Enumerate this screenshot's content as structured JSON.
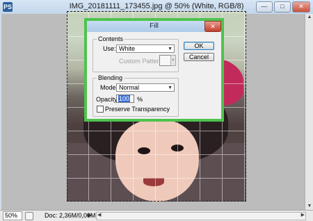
{
  "window": {
    "title": "IMG_20181111_173455.jpg @ 50% (White, RGB/8)",
    "app_icon": "PS",
    "controls": {
      "minimize": "—",
      "maximize": "□",
      "close": "✕"
    }
  },
  "status_bar": {
    "zoom": "50%",
    "doc_size": "Doc: 2,36M/0,00M",
    "arrow": "▶"
  },
  "scroll": {
    "up": "▲",
    "down": "▼",
    "left": "◀",
    "right": "▶"
  },
  "fill_dialog": {
    "title": "Fill",
    "close": "✕",
    "contents": {
      "group_label": "Contents",
      "use_label": "Use:",
      "use_value": "White",
      "custom_pattern_label": "Custom Pattern:"
    },
    "blending": {
      "group_label": "Blending",
      "mode_label": "Mode:",
      "mode_value": "Normal",
      "opacity_label": "Opacity:",
      "opacity_value": "100",
      "opacity_unit": "%",
      "preserve_transparency_label": "Preserve Transparency",
      "preserve_transparency_checked": false
    },
    "buttons": {
      "ok": "OK",
      "cancel": "Cancel"
    },
    "caret": "▼"
  },
  "colors": {
    "dialog_highlight": "#4ec34e",
    "close_red": "#c63f2b"
  }
}
